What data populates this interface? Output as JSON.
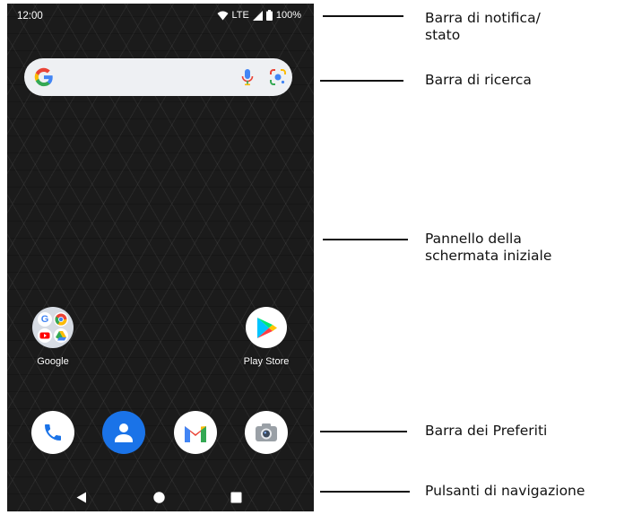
{
  "status_bar": {
    "time": "12:00",
    "network": "LTE",
    "battery": "100%",
    "icons": [
      "wifi-icon",
      "signal-icon",
      "battery-icon"
    ]
  },
  "search_bar": {
    "icons": [
      "google-g-icon",
      "microphone-icon",
      "google-lens-icon"
    ]
  },
  "home_apps": [
    {
      "label": "Google",
      "icon": "google-folder-icon"
    },
    {
      "label": "Play Store",
      "icon": "play-store-icon"
    }
  ],
  "dock": [
    {
      "icon": "phone-icon",
      "color": "#ffffff"
    },
    {
      "icon": "contacts-icon",
      "color": "#1a73e8"
    },
    {
      "icon": "gmail-icon",
      "color": "#ffffff"
    },
    {
      "icon": "camera-icon",
      "color": "#ffffff"
    }
  ],
  "nav_buttons": [
    "back-icon",
    "home-icon",
    "recents-icon"
  ],
  "callouts": {
    "status": "Barra di notifica/\nstato",
    "search": "Barra di ricerca",
    "home_panel": "Pannello della\nschermata iniziale",
    "favorites": "Barra dei Preferiti",
    "navigation": "Pulsanti di navigazione"
  },
  "colors": {
    "wallpaper": "#1b1b1b",
    "search_bg": "#eef0f3",
    "google_blue": "#4285f4",
    "google_red": "#ea4335",
    "google_yellow": "#fbbc05",
    "google_green": "#34a853"
  }
}
